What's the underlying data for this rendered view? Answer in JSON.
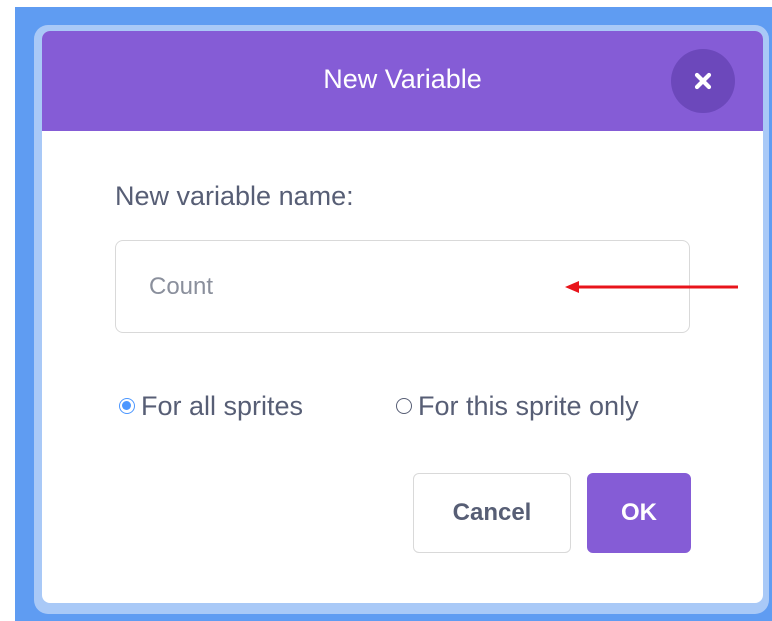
{
  "dialog": {
    "title": "New Variable",
    "close_icon": "close-icon",
    "field_label": "New variable name:",
    "name_input": {
      "value": "",
      "placeholder": "Count"
    },
    "scope_options": [
      {
        "label": "For all sprites",
        "checked": true
      },
      {
        "label": "For this sprite only",
        "checked": false
      }
    ],
    "cancel_label": "Cancel",
    "ok_label": "OK"
  },
  "colors": {
    "header": "#855cd6",
    "accent_blue": "#4c97ff",
    "backdrop": "#5f9cf2",
    "arrow": "#e8141b"
  }
}
